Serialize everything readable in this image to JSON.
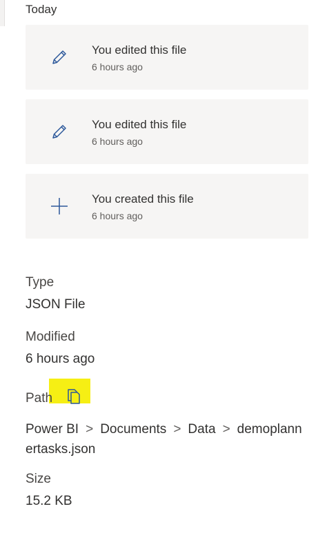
{
  "activity": {
    "section_title": "Today",
    "items": [
      {
        "icon": "pencil-icon",
        "title": "You edited this file",
        "time": "6 hours ago"
      },
      {
        "icon": "pencil-icon",
        "title": "You edited this file",
        "time": "6 hours ago"
      },
      {
        "icon": "plus-icon",
        "title": "You created this file",
        "time": "6 hours ago"
      }
    ]
  },
  "details": {
    "type_label": "Type",
    "type_value": "JSON File",
    "modified_label": "Modified",
    "modified_value": "6 hours ago",
    "path_label": "Path",
    "path_crumbs": [
      "Power BI",
      "Documents",
      "Data",
      "demoplannertasks.json"
    ],
    "path_separator": ">",
    "size_label": "Size",
    "size_value": "15.2 KB"
  },
  "colors": {
    "accent": "#2b579a",
    "card_background": "#f6f5f4",
    "highlight": "#f6ef14"
  }
}
